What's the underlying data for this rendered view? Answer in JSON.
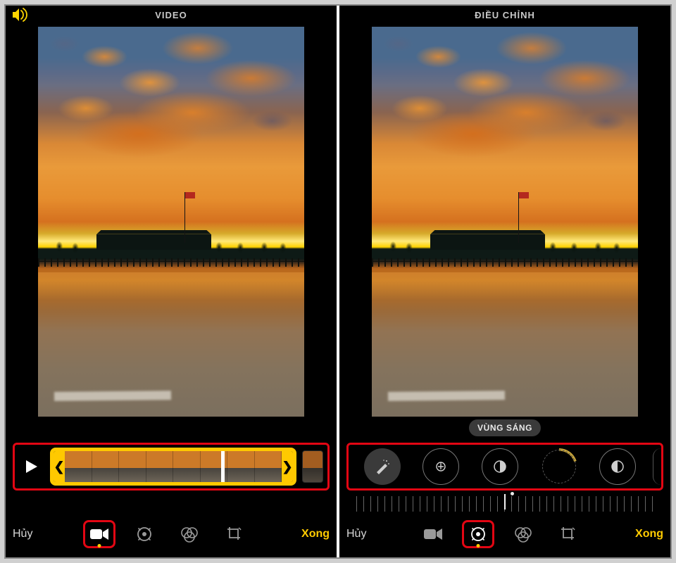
{
  "colors": {
    "accent": "#ffcb00",
    "highlight_box": "#e30613",
    "bg": "#000000"
  },
  "left": {
    "title": "VIDEO",
    "play_label": "Play",
    "trim": {
      "thumbnail_count": 8
    },
    "bottom": {
      "cancel": "Hủy",
      "done": "Xong",
      "active_tool": "video"
    }
  },
  "right": {
    "title": "ĐIỀU CHỈNH",
    "current_adjustment": "VÙNG SÁNG",
    "dials": [
      {
        "id": "auto",
        "icon": "wand-icon"
      },
      {
        "id": "exposure",
        "icon": "exposure-icon"
      },
      {
        "id": "brilliance",
        "icon": "half-circle-icon"
      },
      {
        "id": "highlights",
        "icon": "stripes-circle-icon",
        "selected": true
      },
      {
        "id": "shadows",
        "icon": "contrast-icon"
      }
    ],
    "bottom": {
      "cancel": "Hủy",
      "done": "Xong",
      "active_tool": "adjust"
    }
  },
  "tools": {
    "video": "video-icon",
    "adjust": "adjust-icon",
    "filters": "filters-icon",
    "crop": "crop-icon"
  }
}
